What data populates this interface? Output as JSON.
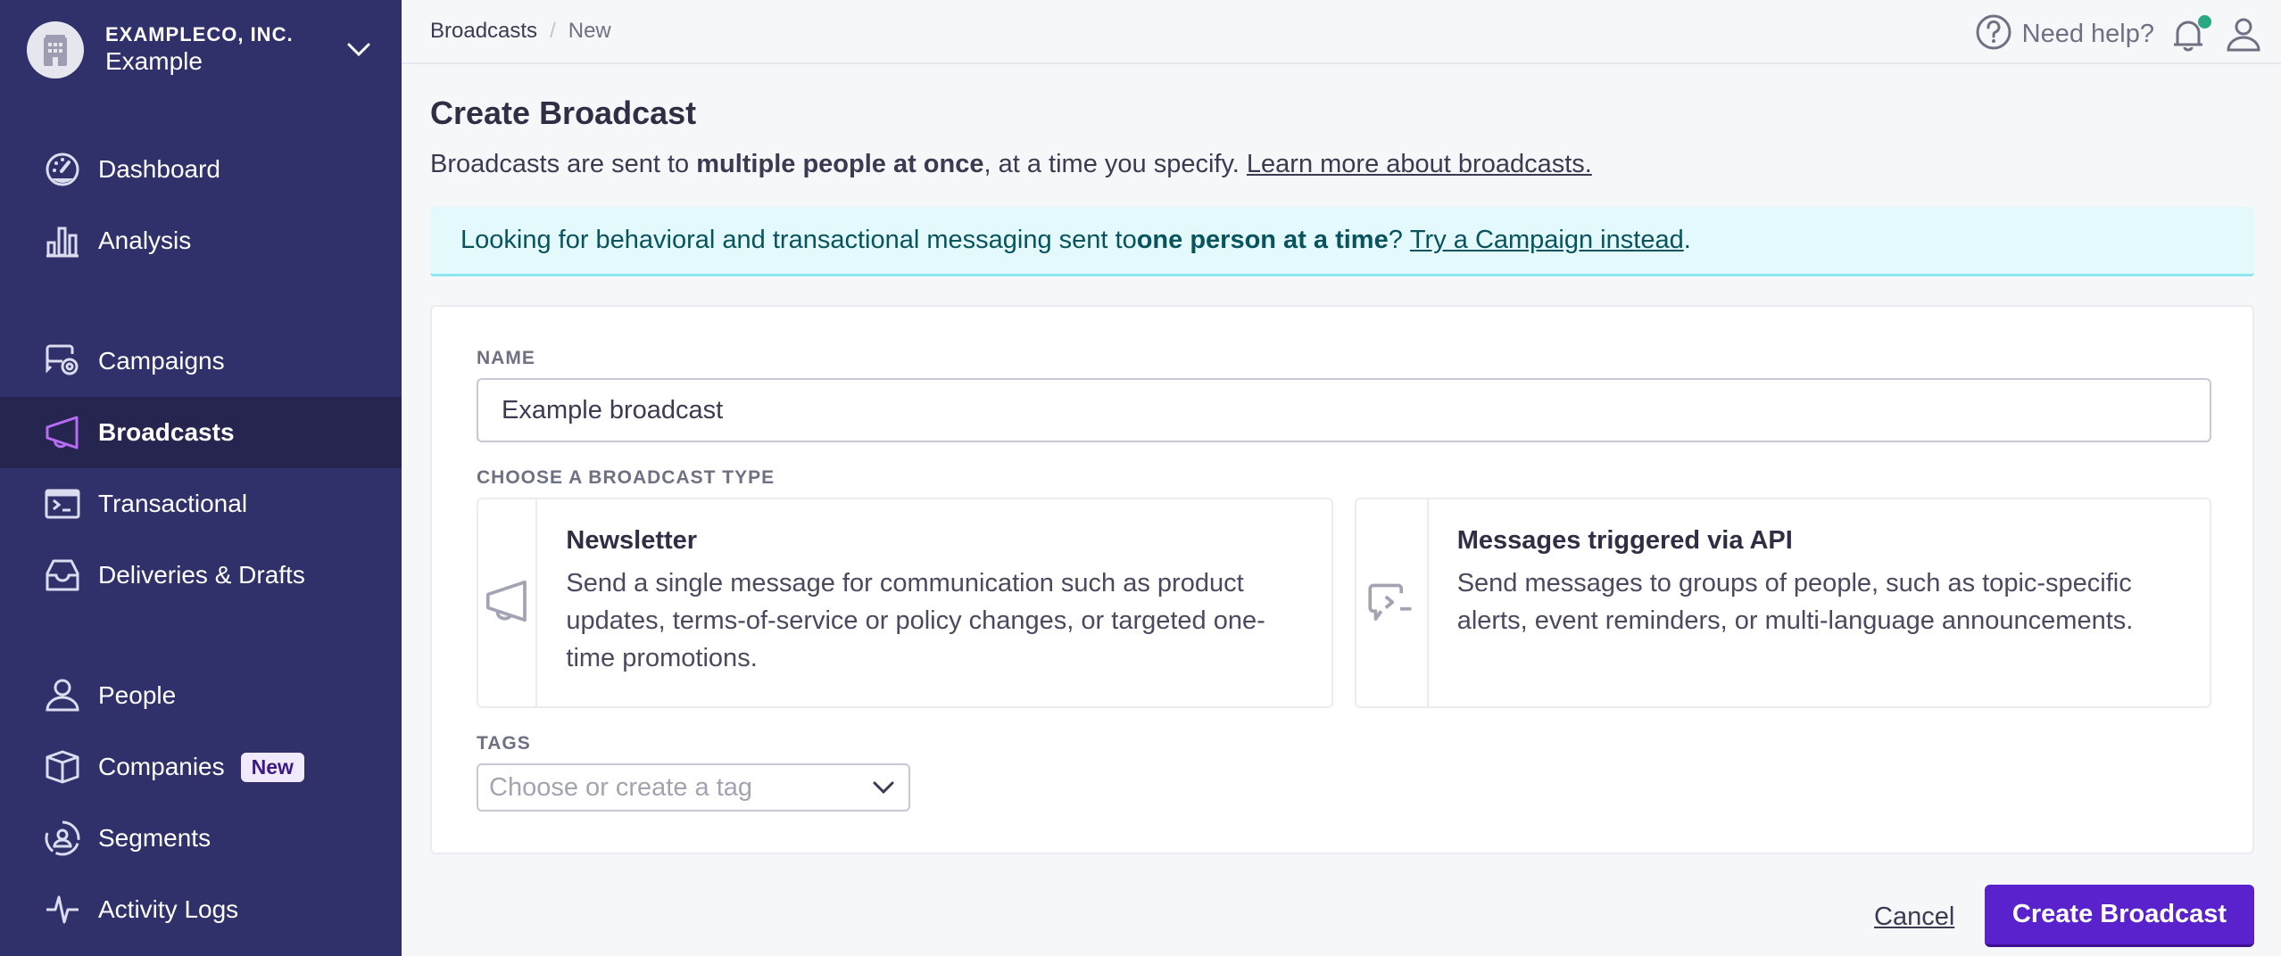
{
  "org": {
    "company": "EXAMPLECO, INC.",
    "workspace": "Example",
    "avatar_icon": "building-icon",
    "toggle_icon": "chevron-down-icon"
  },
  "sidebar": {
    "items": [
      {
        "label": "Dashboard",
        "icon": "gauge-icon",
        "active": false
      },
      {
        "label": "Analysis",
        "icon": "bar-chart-icon",
        "active": false
      },
      {
        "label": "Campaigns",
        "icon": "campaign-icon",
        "active": false
      },
      {
        "label": "Broadcasts",
        "icon": "megaphone-icon",
        "active": true
      },
      {
        "label": "Transactional",
        "icon": "terminal-icon",
        "active": false
      },
      {
        "label": "Deliveries & Drafts",
        "icon": "inbox-icon",
        "active": false
      },
      {
        "label": "People",
        "icon": "person-icon",
        "active": false
      },
      {
        "label": "Companies",
        "icon": "cube-icon",
        "active": false,
        "badge": "New"
      },
      {
        "label": "Segments",
        "icon": "segment-icon",
        "active": false
      },
      {
        "label": "Activity Logs",
        "icon": "pulse-icon",
        "active": false
      }
    ],
    "accent_color": "#b86cf5"
  },
  "header": {
    "breadcrumb": [
      "Broadcasts",
      "New"
    ],
    "help_label": "Need help?",
    "notification_dot_color": "#2aa882"
  },
  "page": {
    "title": "Create Broadcast",
    "description_pre": "Broadcasts are sent to ",
    "description_bold": "multiple people at once",
    "description_post": ", at a time you specify. ",
    "description_link": "Learn more about broadcasts."
  },
  "banner": {
    "pre": "Looking for behavioral and transactional messaging sent to ",
    "bold": "one person at a time",
    "mid": "? ",
    "link": "Try a Campaign instead",
    "post": "."
  },
  "form": {
    "name_label": "NAME",
    "name_value": "Example broadcast",
    "type_label": "CHOOSE A BROADCAST TYPE",
    "types": [
      {
        "title": "Newsletter",
        "description": "Send a single message for communication such as product updates, terms-of-service or policy changes, or targeted one-time promotions.",
        "icon": "megaphone-icon"
      },
      {
        "title": "Messages triggered via API",
        "description": "Send messages to groups of people, such as topic-specific alerts, event reminders, or multi-language announcements.",
        "icon": "api-message-icon"
      }
    ],
    "tags_label": "TAGS",
    "tags_placeholder": "Choose or create a tag"
  },
  "actions": {
    "cancel_label": "Cancel",
    "submit_label": "Create Broadcast",
    "primary_color": "#5a22cc"
  }
}
